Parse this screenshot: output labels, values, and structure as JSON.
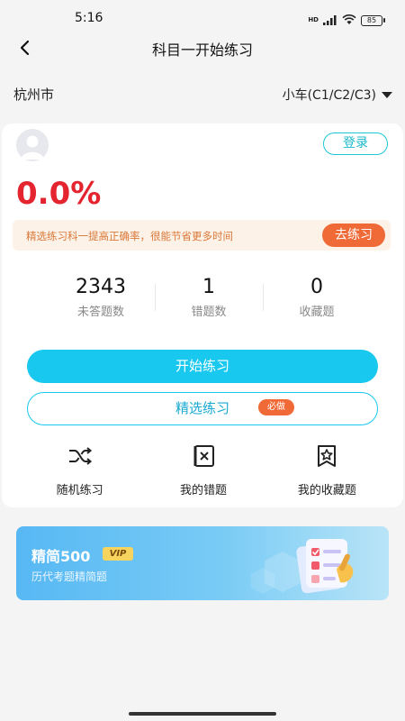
{
  "status_bar": {
    "time": "5:16",
    "battery_level": "85",
    "icons": [
      "hd-icon",
      "signal-icon",
      "wifi-icon",
      "battery-icon"
    ]
  },
  "nav": {
    "title": "科目一开始练习",
    "back_icon": "chevron-left-icon"
  },
  "location": {
    "city": "杭州市",
    "car_type": "小车(C1/C2/C3)"
  },
  "card": {
    "login_label": "登录",
    "accuracy": "0.0%",
    "tip_text": "精选练习科一提高正确率，很能节省更多时间",
    "tip_button": "去练习",
    "stats": [
      {
        "value": "2343",
        "label": "未答题数"
      },
      {
        "value": "1",
        "label": "错题数"
      },
      {
        "value": "0",
        "label": "收藏题"
      }
    ],
    "start_button": "开始练习",
    "select_button": "精选练习",
    "select_badge": "必做",
    "tools": [
      {
        "label": "随机练习",
        "icon": "shuffle-icon"
      },
      {
        "label": "我的错题",
        "icon": "wrong-book-icon"
      },
      {
        "label": "我的收藏题",
        "icon": "star-bookmark-icon"
      }
    ]
  },
  "promo": {
    "title": "精简500",
    "badge": "VIP",
    "subtitle": "历代考题精简题"
  },
  "colors": {
    "accent": "#19c8ef",
    "accuracy_red": "#e4242f",
    "orange": "#ef6a37",
    "tip_bg": "#fdf2e7"
  }
}
